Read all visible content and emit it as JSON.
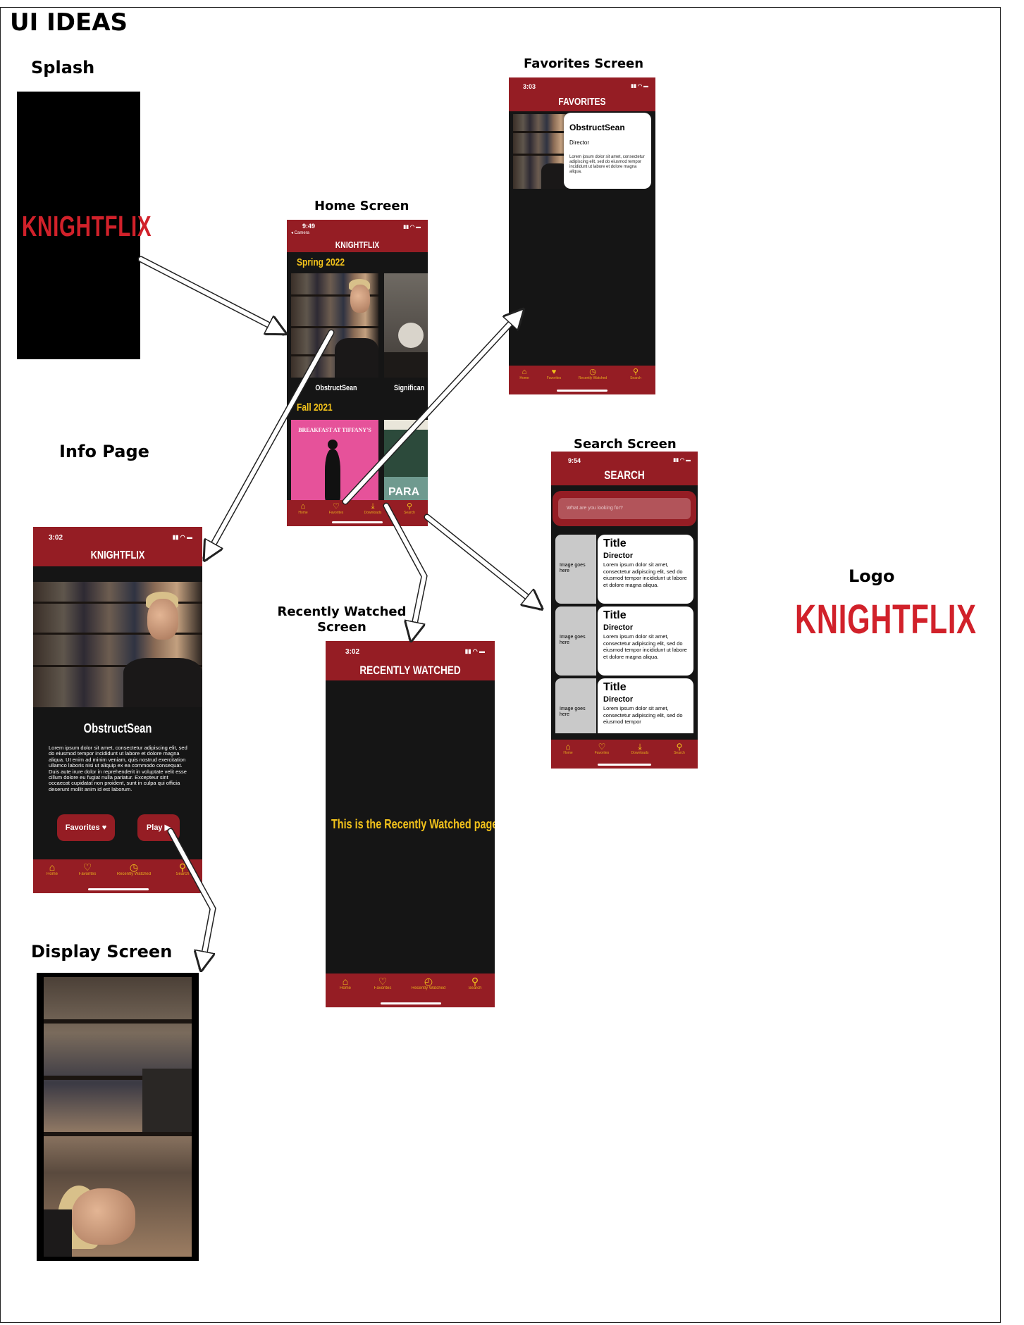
{
  "page_title": "UI IDEAS",
  "labels": {
    "splash": "Splash",
    "home": "Home Screen",
    "favorites": "Favorites Screen",
    "info": "Info Page",
    "search": "Search Screen",
    "recent": "Recently Watched Screen",
    "display": "Display Screen",
    "logo": "Logo"
  },
  "logo_text": "KNIGHTFLIX",
  "tabs": {
    "home": "Home",
    "favorites": "Favorites",
    "downloads": "Downloads",
    "recently_watched": "Recently Watched",
    "search": "Search"
  },
  "home_screen": {
    "time": "9:49",
    "back": "◂ Camera",
    "title": "KNIGHTFLIX",
    "sections": [
      {
        "heading": "Spring 2022",
        "items": [
          "ObstructSean",
          "Significan"
        ]
      },
      {
        "heading": "Fall 2021",
        "items": [
          "BREAKFAST AT TIFFANY'S",
          "PARA"
        ]
      }
    ]
  },
  "favorites_screen": {
    "time": "3:03",
    "title": "FAVORITES",
    "card": {
      "name": "ObstructSean",
      "role": "Director",
      "body": "Lorem ipsum dolor sit amet, consectetur adipiscing elit, sed do eiusmod tempor incididunt ut labore et dolore magna aliqua."
    }
  },
  "info_screen": {
    "time": "3:02",
    "title": "KNIGHTFLIX",
    "name": "ObstructSean",
    "body": "Lorem ipsum dolor sit amet, consectetur adipiscing elit, sed do eiusmod tempor incididunt ut labore et dolore magna aliqua. Ut enim ad minim veniam, quis nostrud exercitation ullamco laboris nisi ut aliquip ex ea commodo consequat. Duis aute irure dolor in reprehenderit in voluptate velit esse cillum dolore eu fugiat nulla pariatur. Excepteur sint occaecat cupidatat non proident, sunt in culpa qui officia deserunt mollit anim id est laborum.",
    "favorites_button": "Favorites",
    "play_button": "Play"
  },
  "search_screen": {
    "time": "9:54",
    "title": "SEARCH",
    "placeholder": "What are you looking for?",
    "results": [
      {
        "image": "Image goes here",
        "title": "Title",
        "director": "Director",
        "body": "Lorem ipsum dolor sit amet, consectetur adipiscing elit, sed do eiusmod tempor incididunt ut labore et dolore magna aliqua."
      },
      {
        "image": "Image goes here",
        "title": "Title",
        "director": "Director",
        "body": "Lorem ipsum dolor sit amet, consectetur adipiscing elit, sed do eiusmod tempor incididunt ut labore et dolore magna aliqua."
      },
      {
        "image": "Image goes here",
        "title": "Title",
        "director": "Director",
        "body": "Lorem ipsum dolor sit amet, consectetur adipiscing elit, sed do eiusmod tempor"
      }
    ]
  },
  "recent_screen": {
    "time": "3:02",
    "title": "RECENTLY WATCHED",
    "message": "This is the Recently Watched page"
  },
  "colors": {
    "brand_red": "#951d24",
    "logo_red": "#d1212a",
    "accent_yellow": "#f2c21b",
    "dark_bg": "#151515"
  }
}
